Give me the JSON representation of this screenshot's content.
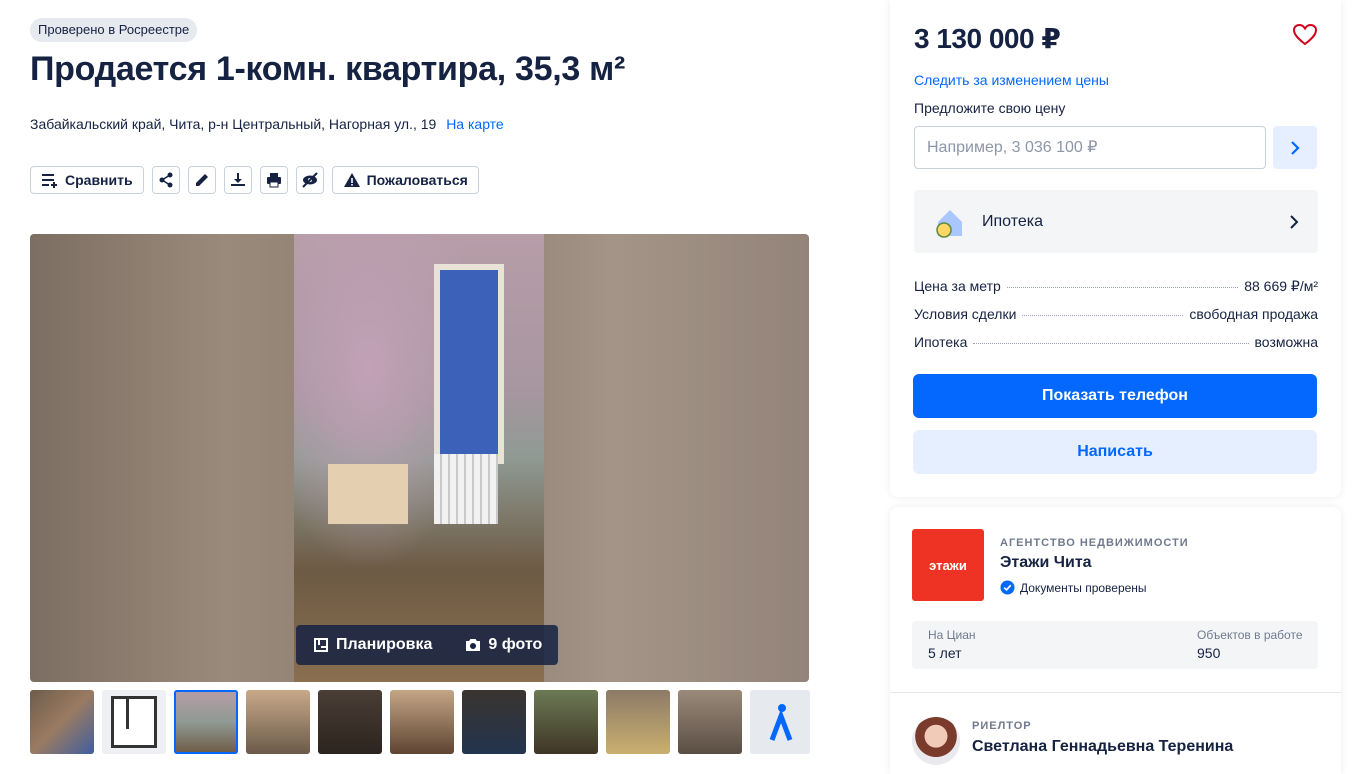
{
  "badge": "Проверено в Росреестре",
  "title": "Продается 1-комн. квартира, 35,3 м²",
  "address": {
    "text": "Забайкальский край, Чита, р-н Центральный, Нагорная ул., 19",
    "map_link": "На карте"
  },
  "toolbar": {
    "compare": "Сравнить",
    "report": "Пожаловаться",
    "icons": [
      "share-icon",
      "edit-icon",
      "download-icon",
      "print-icon",
      "hide-icon"
    ]
  },
  "gallery": {
    "plan_label": "Планировка",
    "photos_label": "9 фото",
    "thumbnail_count": 10,
    "active_thumbnail": 3
  },
  "offer": {
    "price": "3 130 000 ₽",
    "watch_link": "Следить за изменением цены",
    "suggest_label": "Предложите свою цену",
    "suggest_placeholder": "Например, 3 036 100 ₽",
    "mortgage_label": "Ипотека",
    "facts": [
      {
        "label": "Цена за метр",
        "value": "88 669 ₽/м²"
      },
      {
        "label": "Условия сделки",
        "value": "свободная продажа"
      },
      {
        "label": "Ипотека",
        "value": "возможна"
      }
    ],
    "phone_button": "Показать телефон",
    "write_button": "Написать"
  },
  "agency": {
    "type": "АГЕНТСТВО НЕДВИЖИМОСТИ",
    "name": "Этажи Чита",
    "logo_text": "этажи",
    "verified": "Документы проверены",
    "stats": [
      {
        "label": "На Циан",
        "value": "5 лет"
      },
      {
        "label": "Объектов в работе",
        "value": "950"
      }
    ]
  },
  "realtor": {
    "type": "РИЕЛТОР",
    "name": "Светлана Геннадьевна Теренина"
  },
  "colors": {
    "primary": "#0468ff",
    "text": "#152242",
    "heart": "#d0021b",
    "agency_brand": "#ee3224"
  }
}
